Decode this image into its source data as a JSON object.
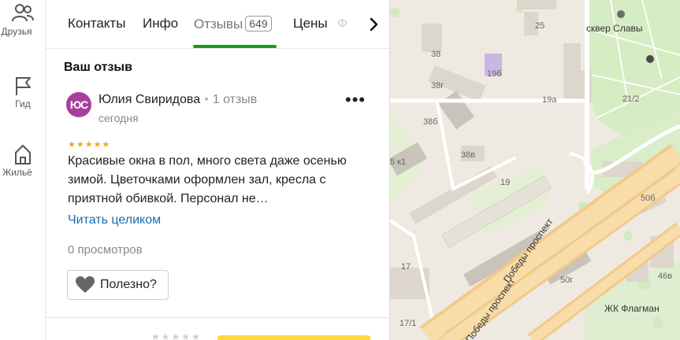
{
  "nav": {
    "items": [
      {
        "label": "Друзья",
        "icon": "people-icon"
      },
      {
        "label": "Гид",
        "icon": "flag-icon"
      },
      {
        "label": "Жильё",
        "icon": "house-icon"
      }
    ]
  },
  "tabs": {
    "contacts": "Контакты",
    "info": "Инфо",
    "reviews": "Отзывы",
    "reviews_count": "649",
    "prices": "Цены",
    "faded": "Ф"
  },
  "review": {
    "section_title": "Ваш отзыв",
    "avatar_initials": "ЮС",
    "author": "Юлия Свиридова",
    "author_reviews": "1 отзыв",
    "date": "сегодня",
    "rating": 5,
    "text": "Красивые окна в пол, много света даже осенью зимой. Цветочками оформлен зал, кресла с приятной обивкой. Персонал не…",
    "read_more": "Читать целиком",
    "views": "0 просмотров",
    "useful_label": "Полезно?"
  },
  "map": {
    "labels": {
      "park": "сквер Славы",
      "b25": "25",
      "b38": "38",
      "b38g": "38г",
      "b19b": "19б",
      "b19a": "19а",
      "b38b": "38б",
      "b212": "21/2",
      "b38v": "38в",
      "b19": "19",
      "b5k1": "5 к1",
      "b50b": "50б",
      "b17": "17",
      "b50g": "50г",
      "b46v": "46в",
      "b171": "17/1",
      "street1": "Победы проспект",
      "street2": "Победы проспект",
      "complex": "ЖК Флагман"
    }
  },
  "colors": {
    "accent_green": "#1a9a1a",
    "link_blue": "#1a6cb5",
    "star_gold": "#f5a623",
    "avatar_purple": "#a93f9b",
    "button_yellow": "#ffd840"
  }
}
